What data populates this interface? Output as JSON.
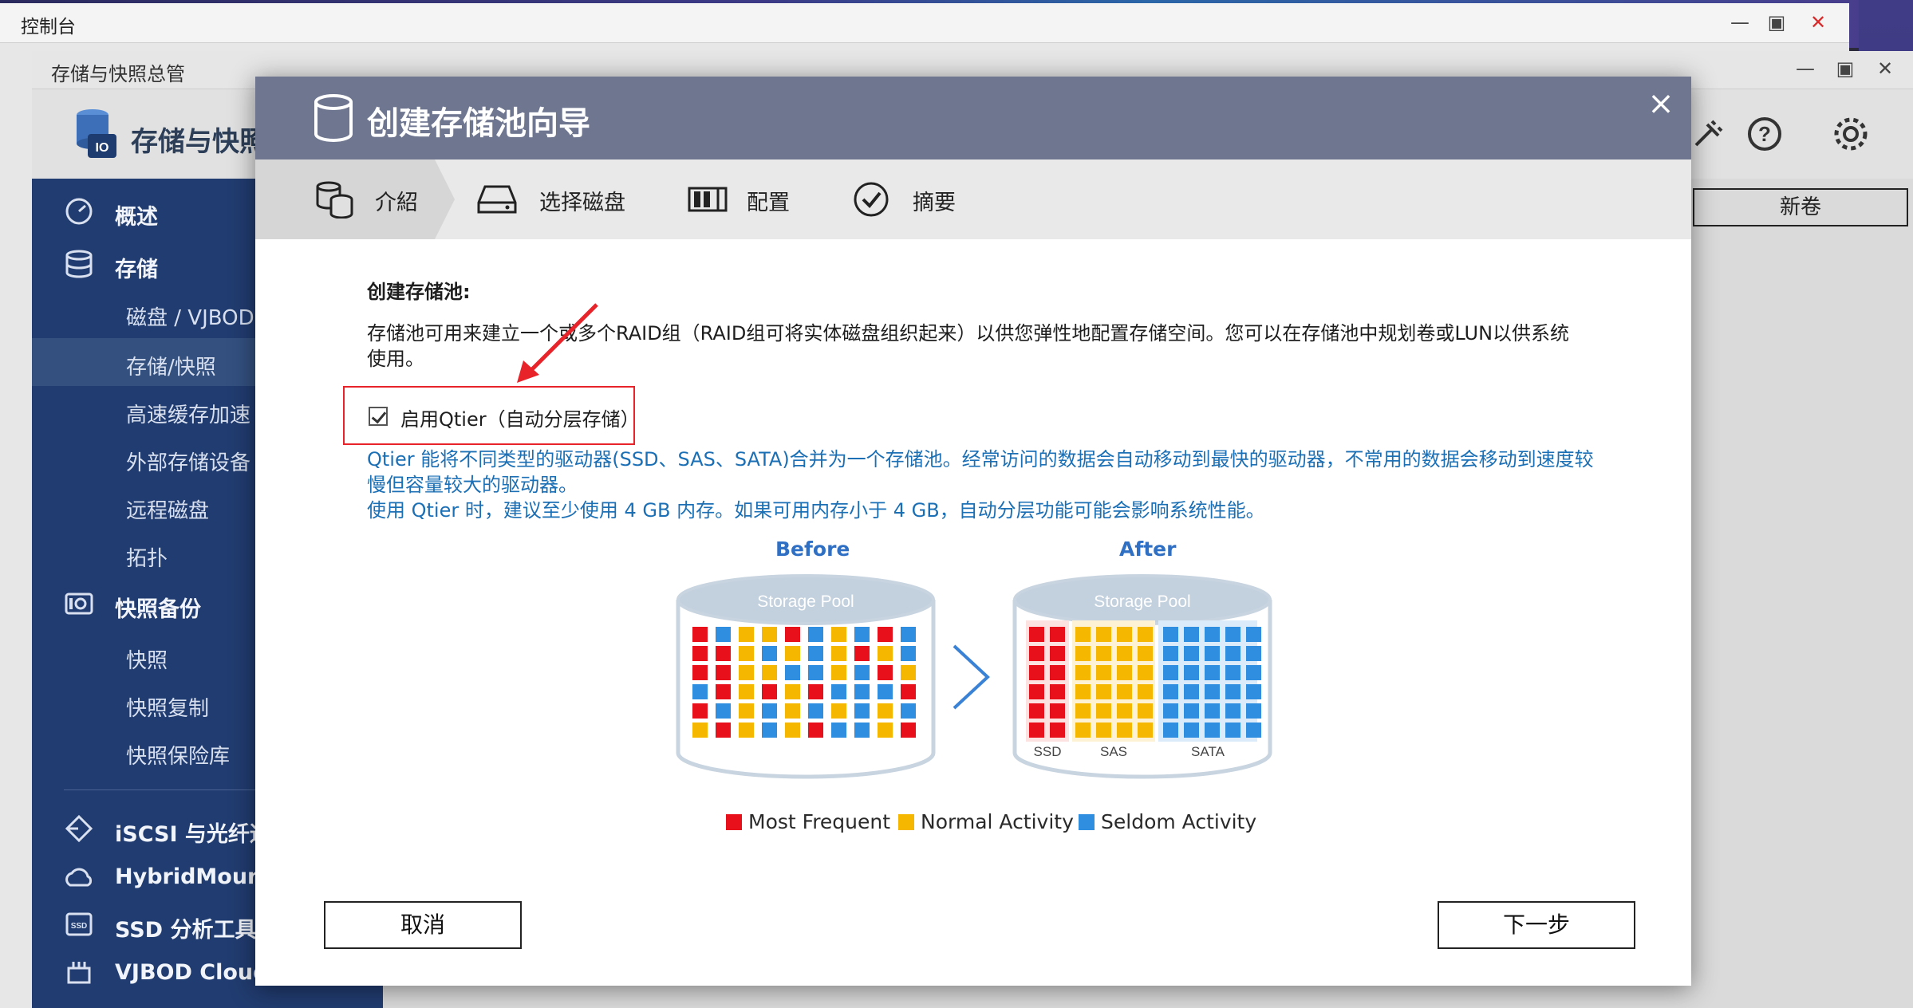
{
  "console": {
    "title": "控制台",
    "min_icon": "minimize-icon",
    "max_icon": "maximize-icon",
    "close_icon": "close-icon"
  },
  "app": {
    "window_title": "存储与快照总管",
    "name": "存储与快照",
    "new_volume_label": "新卷"
  },
  "sidebar": {
    "items": [
      {
        "label": "概述",
        "icon": "dashboard-icon",
        "level": "main"
      },
      {
        "label": "存储",
        "icon": "database-icon",
        "level": "main"
      },
      {
        "label": "磁盘 / VJBOD",
        "level": "sub"
      },
      {
        "label": "存储/快照",
        "level": "sub",
        "active": true
      },
      {
        "label": "高速缓存加速",
        "level": "sub"
      },
      {
        "label": "外部存储设备",
        "level": "sub"
      },
      {
        "label": "远程磁盘",
        "level": "sub"
      },
      {
        "label": "拓扑",
        "level": "sub"
      },
      {
        "label": "快照备份",
        "icon": "snapshot-icon",
        "level": "main"
      },
      {
        "label": "快照",
        "level": "sub"
      },
      {
        "label": "快照复制",
        "level": "sub"
      },
      {
        "label": "快照保险库",
        "level": "sub"
      },
      {
        "label": "iSCSI 与光纤通",
        "icon": "iscsi-icon",
        "level": "main"
      },
      {
        "label": "HybridMount",
        "icon": "cloud-mount-icon",
        "level": "main"
      },
      {
        "label": "SSD 分析工具",
        "icon": "ssd-icon",
        "level": "main"
      },
      {
        "label": "VJBOD Cloud",
        "icon": "vjbod-cloud-icon",
        "level": "main"
      }
    ]
  },
  "modal": {
    "title": "创建存储池向导",
    "close_label": "×",
    "steps": [
      {
        "label": "介紹",
        "icon": "intro-icon"
      },
      {
        "label": "选择磁盘",
        "icon": "disk-icon"
      },
      {
        "label": "配置",
        "icon": "config-icon"
      },
      {
        "label": "摘要",
        "icon": "check-circle-icon"
      }
    ],
    "content_title": "创建存储池:",
    "content_desc": "存储池可用来建立一个或多个RAID组（RAID组可将实体磁盘组织起来）以供您弹性地配置存储空间。您可以在存储池中规划卷或LUN以供系统使用。",
    "qtier_label": "启用Qtier（自动分层存储）",
    "qtier_checked": true,
    "qtier_info_1": "Qtier 能将不同类型的驱动器(SSD、SAS、SATA)合并为一个存储池。经常访问的数据会自动移动到最快的驱动器，不常用的数据会移动到速度较慢但容量较大的驱动器。",
    "qtier_info_2": "使用 Qtier 时，建议至少使用 4 GB 内存。如果可用内存小于 4 GB，自动分层功能可能会影响系统性能。",
    "diagram": {
      "before_label": "Before",
      "after_label": "After",
      "pool_label": "Storage Pool",
      "tier_labels": [
        "SSD",
        "SAS",
        "SATA"
      ],
      "legend": [
        {
          "label": "Most Frequent",
          "color": "#e8101a"
        },
        {
          "label": "Normal Activity",
          "color": "#f5b700"
        },
        {
          "label": "Seldom Activity",
          "color": "#2f8ee0"
        }
      ]
    },
    "cancel_label": "取消",
    "next_label": "下一步"
  }
}
